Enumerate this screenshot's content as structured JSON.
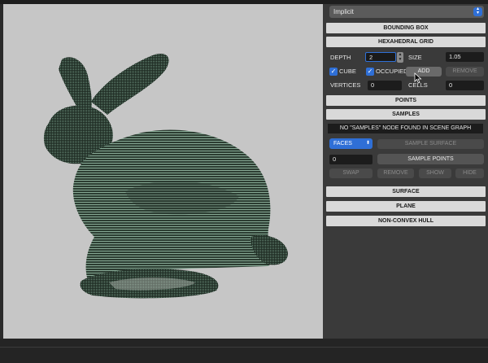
{
  "dropdown": {
    "selected": "Implicit",
    "arrow_icon": "up-down-chevron-icon"
  },
  "sections": {
    "bounding_box": "BOUNDING BOX",
    "hexahedral_grid": "HEXAHEDRAL GRID",
    "points": "POINTS",
    "samples": "SAMPLES",
    "surface": "SURFACE",
    "plane": "PLANE",
    "non_convex_hull": "NON-CONVEX HULL"
  },
  "grid": {
    "depth_label": "DEPTH",
    "depth_value": "2",
    "size_label": "SIZE",
    "size_value": "1.05",
    "cube_label": "CUBE",
    "occupied_label": "OCCUPIED",
    "add_label": "ADD",
    "remove_label": "REMOVE",
    "vertices_label": "VERTICES",
    "vertices_value": "0",
    "cells_label": "CELLS",
    "cells_value": "0"
  },
  "samples": {
    "message": "NO \"SAMPLES\" NODE FOUND IN SCENE GRAPH",
    "faces_option": "FACES",
    "sample_surface_label": "SAMPLE SURFACE",
    "count_value": "0",
    "sample_points_label": "SAMPLE POINTS",
    "swap_label": "SWAP",
    "remove_label": "REMOVE",
    "show_label": "SHOW",
    "hide_label": "HIDE"
  },
  "viewport": {
    "background": "#c6c6c6",
    "mesh_color": "#5a7d68",
    "mesh_dark": "#1e2a22"
  },
  "colors": {
    "accent": "#2f6fd6",
    "panel": "#3a3a3a",
    "header": "#d9d9d9"
  }
}
